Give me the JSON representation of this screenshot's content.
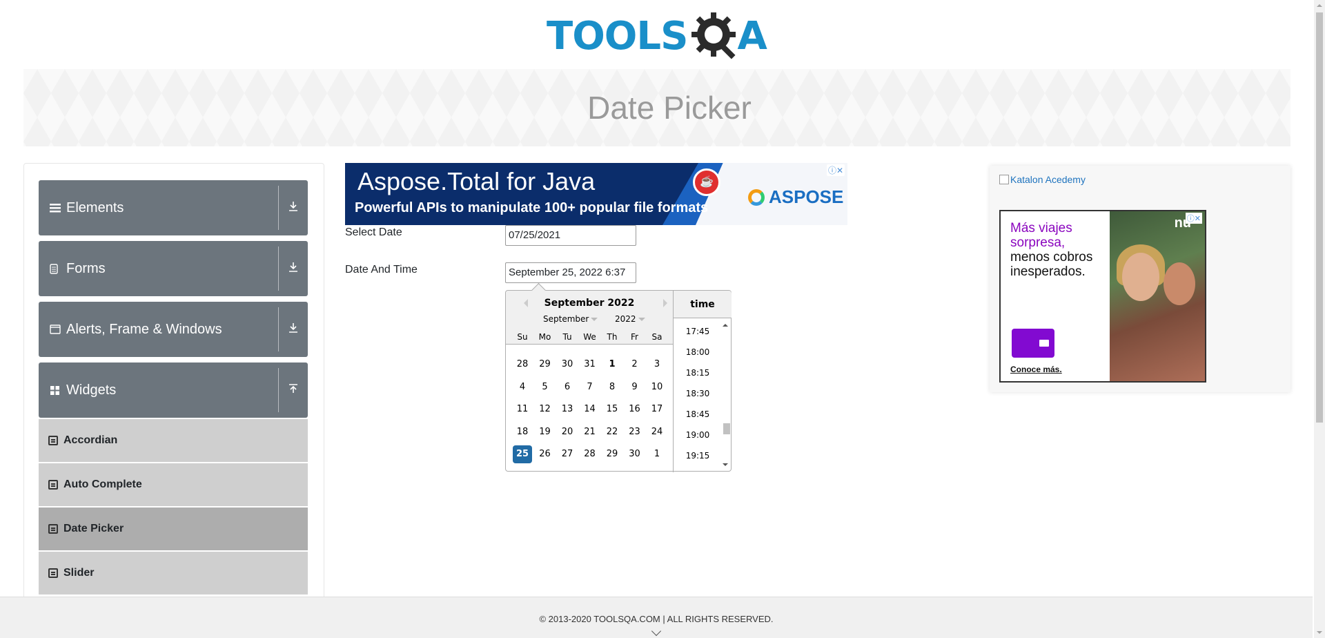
{
  "header": {
    "logo_text_a": "TOOLS",
    "logo_text_b": "A"
  },
  "banner": {
    "title": "Date Picker"
  },
  "sidebar": {
    "groups": [
      {
        "label": "Elements",
        "icon": "hamburger-icon",
        "arrow": "download-arrow-icon"
      },
      {
        "label": "Forms",
        "icon": "document-icon",
        "arrow": "download-arrow-icon"
      },
      {
        "label": "Alerts, Frame & Windows",
        "icon": "window-icon",
        "arrow": "download-arrow-icon"
      },
      {
        "label": "Widgets",
        "icon": "grid-icon",
        "arrow": "upload-arrow-icon"
      }
    ],
    "items": [
      {
        "label": "Accordian"
      },
      {
        "label": "Auto Complete"
      },
      {
        "label": "Date Picker",
        "active": true
      },
      {
        "label": "Slider"
      }
    ]
  },
  "ad_top": {
    "headline": "Aspose.Total for Java",
    "sub": "Powerful APIs to manipulate 100+ popular file formats",
    "brand": "ASPOSE"
  },
  "form": {
    "select_date_label": "Select Date",
    "select_date_value": "07/25/2021",
    "date_time_label": "Date And Time",
    "date_time_value": "September 25, 2022 6:37"
  },
  "datepicker": {
    "title": "September 2022",
    "month_select": "September",
    "year_select": "2022",
    "weekdays": [
      "Su",
      "Mo",
      "Tu",
      "We",
      "Th",
      "Fr",
      "Sa"
    ],
    "weeks": [
      [
        "28",
        "29",
        "30",
        "31",
        "1",
        "2",
        "3"
      ],
      [
        "4",
        "5",
        "6",
        "7",
        "8",
        "9",
        "10"
      ],
      [
        "11",
        "12",
        "13",
        "14",
        "15",
        "16",
        "17"
      ],
      [
        "18",
        "19",
        "20",
        "21",
        "22",
        "23",
        "24"
      ],
      [
        "25",
        "26",
        "27",
        "28",
        "29",
        "30",
        "1"
      ]
    ],
    "selected_day": "25",
    "time_header": "time",
    "times": [
      "17:45",
      "18:00",
      "18:15",
      "18:30",
      "18:45",
      "19:00",
      "19:15"
    ]
  },
  "ad_right": {
    "broken_image_alt": "Katalon Acedemy",
    "line1": "Más viajes",
    "line2": "sorpresa,",
    "line3": "menos cobros",
    "line4": "inesperados.",
    "cta": "Conoce más.",
    "brand": "nu"
  },
  "footer": {
    "text": "© 2013-2020 TOOLSQA.COM | ALL RIGHTS RESERVED."
  }
}
